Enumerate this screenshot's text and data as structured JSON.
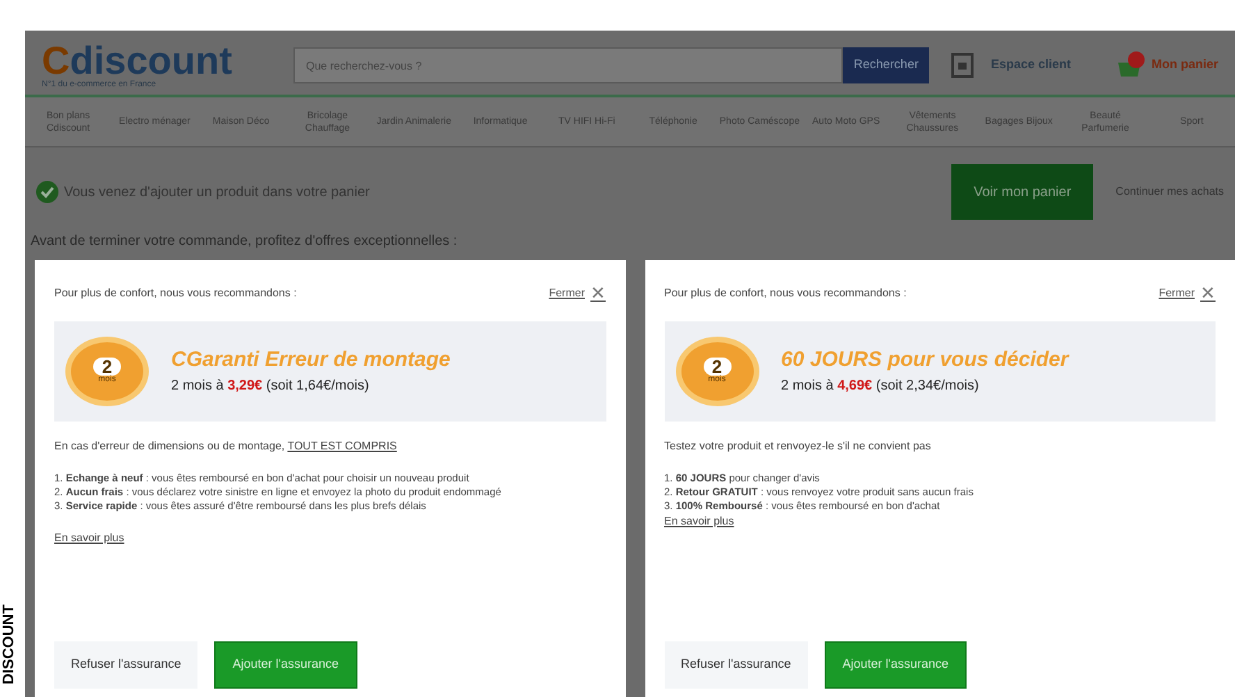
{
  "side_credit": "DISCOUNT",
  "header": {
    "logo_initial": "C",
    "logo_rest": "discount",
    "tagline": "N°1 du e-commerce en France",
    "search_placeholder": "Que recherchez-vous ?",
    "search_button": "Rechercher",
    "account": "Espace client",
    "cart": "Mon panier"
  },
  "nav": [
    {
      "label": "Bon plans Cdiscount"
    },
    {
      "label": "Electro ménager"
    },
    {
      "label": "Maison Déco"
    },
    {
      "label": "Bricolage Chauffage"
    },
    {
      "label": "Jardin Animalerie"
    },
    {
      "label": "Informatique"
    },
    {
      "label": "TV HIFI Hi-Fi"
    },
    {
      "label": "Téléphonie"
    },
    {
      "label": "Photo Caméscope"
    },
    {
      "label": "Auto Moto GPS"
    },
    {
      "label": "Vêtements Chaussures"
    },
    {
      "label": "Bagages Bijoux"
    },
    {
      "label": "Beauté Parfumerie"
    },
    {
      "label": "Sport"
    }
  ],
  "confirmation": {
    "message": "Vous venez d'ajouter un produit dans votre panier",
    "view_cart": "Voir mon panier",
    "continue": "Continuer mes achats"
  },
  "prompt": "Avant de terminer votre commande, profitez d'offres exceptionnelles :",
  "offers": [
    {
      "intro": "Pour plus de confort, nous vous recommandons :",
      "close": "Fermer",
      "close_glyph": "✕",
      "badge_number": "2",
      "badge_unit": "mois",
      "title": "CGaranti Erreur de montage",
      "price_prefix": "2 mois à ",
      "price": "3,29€",
      "price_suffix": " (soit 1,64€/mois)",
      "description": "En cas d'erreur de dimensions ou de montage, ",
      "description_link": "TOUT EST COMPRIS",
      "points": [
        "1. **Echange à neuf** : vous êtes remboursé en bon d'achat pour choisir un nouveau produit",
        "2. **Aucun frais** : vous déclarez votre sinistre en ligne et envoyez la photo du produit endommagé",
        "3. **Service rapide** : vous êtes assuré d'être remboursé dans les plus brefs délais"
      ],
      "more": "En savoir plus",
      "decline": "Refuser l'assurance",
      "accept": "Ajouter l'assurance"
    },
    {
      "intro": "Pour plus de confort, nous vous recommandons :",
      "close": "Fermer",
      "close_glyph": "✕",
      "badge_number": "2",
      "badge_unit": "mois",
      "title": "60 JOURS pour vous décider",
      "price_prefix": "2 mois à ",
      "price": "4,69€",
      "price_suffix": " (soit 2,34€/mois)",
      "description": "Testez votre produit et renvoyez-le s'il ne convient pas",
      "points": [
        "1. **60 JOURS** pour changer d'avis",
        "2. **Retour GRATUIT** : vous renvoyez votre produit sans aucun frais",
        "3. **100% Remboursé** : vous êtes remboursé en bon d'achat"
      ],
      "more": "En savoir plus",
      "decline": "Refuser l'assurance",
      "accept": "Ajouter l'assurance"
    }
  ]
}
